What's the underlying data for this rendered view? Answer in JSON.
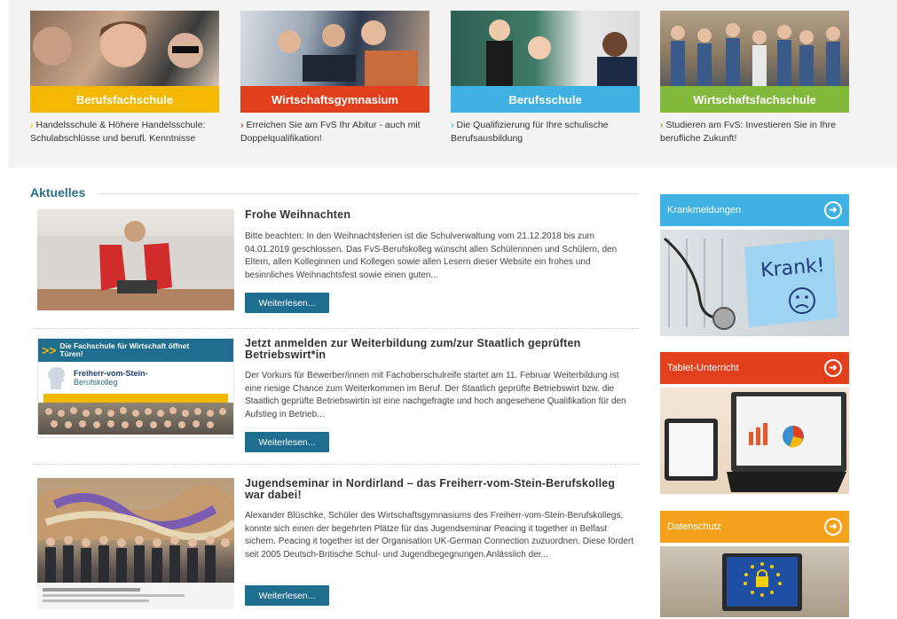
{
  "colors": {
    "yellow": "#f5b800",
    "red": "#e2401d",
    "blue": "#3fb1e3",
    "green": "#82b93a",
    "orange_side": "#ee6a15",
    "amber_side": "#f4a11c",
    "button": "#1f6d8f"
  },
  "school_types": [
    {
      "label": "Berufsfachschule",
      "desc": "Handelsschule & Höhere Handelsschule: Schulabschlüsse und berufl. Kenntnisse",
      "arrow": "›"
    },
    {
      "label": "Wirtschaftsgymnasium",
      "desc": "Erreichen Sie am FvS Ihr Abitur - auch mit Doppelqualifikation!",
      "arrow": "›"
    },
    {
      "label": "Berufsschule",
      "desc": "Die Qualifizierung für Ihre schulische Berufsausbildung",
      "arrow": "›"
    },
    {
      "label": "Wirtschaftsfachschule",
      "desc": "Studieren am FvS: Investieren Sie in Ihre berufliche Zukunft!",
      "arrow": "›"
    }
  ],
  "news": {
    "section_title": "Aktuelles",
    "button_label": "Weiterlesen...",
    "articles": [
      {
        "title": "Frohe Weihnachten",
        "body": "Bitte beachten: In den Weihnachtsferien ist die Schulverwaltung vom 21.12.2018 bis zum 04.01.2019 geschlossen. Das FvS-Berufskolleg wünscht allen Schülerinnen und Schülern, den Eltern, allen Kolleginnen und Kollegen sowie allen Lesern dieser Website ein frohes und besinnliches Weihnachtsfest sowie einen guten..."
      },
      {
        "title": "Jetzt anmelden zur Weiterbildung zum/zur Staatlich geprüften Betriebswirt*in",
        "body": "Der Vorkurs für Bewerber/innen mit Fachoberschulreife startet am 11. Februar Weiterbildung ist eine riesige Chance zum Weiterkommen im Beruf. Der Staatlich geprüfte Betriebswirt bzw. die Staatlich geprüfte Betriebswirtin ist eine nachgefragte und hoch angesehene Qualifikation für den Aufstieg in Betrieb...",
        "banner_line": "Die Fachschule für Wirtschaft öffnet Türen!",
        "banner_logo_1": "Freiherr-vom-Stein-",
        "banner_logo_2": "Berufskolleg"
      },
      {
        "title": "Jugendseminar in Nordirland – das Freiherr-vom-Stein-Berufskolleg war dabei!",
        "body": "Alexander Blüschke, Schüler des Wirtschaftsgymnasiums des Freiherr-vom-Stein-Berufskollegs, konnte sich einen der begehrten Plätze für das Jugendseminar Peacing it together in Belfast sichern. Peacing it together ist der Organisation UK-German Connection zuzuordnen. Diese fördert seit 2005 Deutsch-Britische Schul- und Jugendbegegnungen.Anlässlich der..."
      }
    ]
  },
  "sidebar": [
    {
      "label": "Krankmeldungen",
      "image_text": "Krank!",
      "icon": "arrow-circle-icon"
    },
    {
      "label": "Tablet-Unterricht",
      "icon": "arrow-circle-icon"
    },
    {
      "label": "Datenschutz",
      "icon": "arrow-circle-icon"
    }
  ]
}
